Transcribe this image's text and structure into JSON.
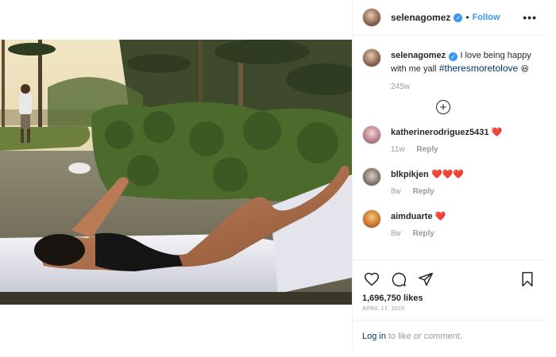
{
  "post": {
    "username": "selenagomez",
    "follow_label": "Follow",
    "separator": "•",
    "more_label": "•••"
  },
  "caption": {
    "username": "selenagomez",
    "text": "I love being happy with me yall",
    "hashtag": "#theresmoretolove",
    "emoji": "😆",
    "time": "245w"
  },
  "load_more_label": "+",
  "comments": [
    {
      "username": "katherinerodriguez5431",
      "text": "❤️",
      "time": "11w",
      "reply_label": "Reply"
    },
    {
      "username": "blkpikjen",
      "text": "❤️❤️❤️",
      "time": "8w",
      "reply_label": "Reply"
    },
    {
      "username": "aimduarte",
      "text": "❤️",
      "time": "8w",
      "reply_label": "Reply"
    }
  ],
  "likes": "1,696,750 likes",
  "date": "APRIL 17, 2015",
  "login": {
    "link_text": "Log in",
    "rest_text": " to like or comment."
  },
  "colors": {
    "accent": "#3897f0",
    "heart": "#ed4956",
    "link": "#003569",
    "muted": "#999999"
  },
  "icons": [
    "heart-icon",
    "comment-icon",
    "share-icon",
    "bookmark-icon",
    "verified-badge-icon",
    "more-options-icon",
    "load-more-icon"
  ]
}
